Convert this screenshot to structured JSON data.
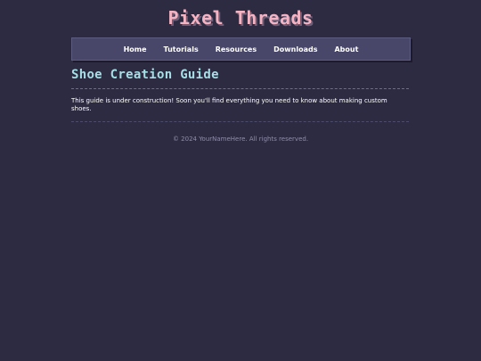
{
  "header": {
    "site_title": "Pixel Threads"
  },
  "nav": {
    "items": [
      {
        "label": "Home"
      },
      {
        "label": "Tutorials"
      },
      {
        "label": "Resources"
      },
      {
        "label": "Downloads"
      },
      {
        "label": "About"
      }
    ]
  },
  "main": {
    "heading": "Shoe Creation Guide",
    "body": "This guide is under construction! Soon you'll find everything you need to know about making custom shoes."
  },
  "footer": {
    "text": "© 2024 YourNameHere. All rights reserved."
  },
  "colors": {
    "background": "#2d2b42",
    "title": "#f4b3c2",
    "heading": "#a6dfe6",
    "nav_bg": "#48476a",
    "footer_text": "#8f8ca8"
  }
}
